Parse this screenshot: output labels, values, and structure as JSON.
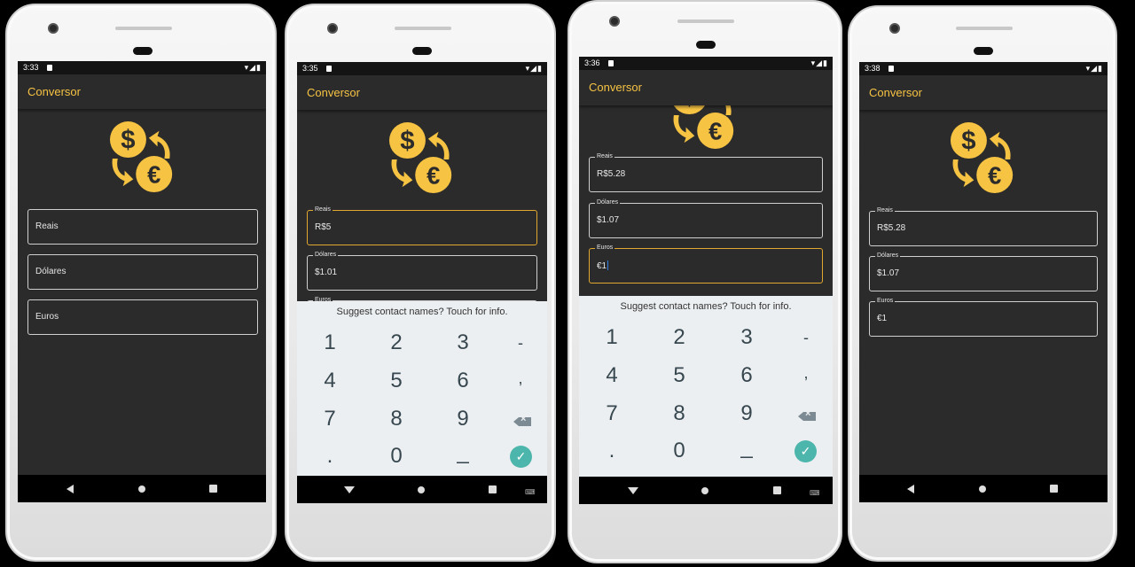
{
  "app": {
    "title": "Conversor",
    "accent": "#f6c343"
  },
  "status": {
    "signal_icons": "▾◢▮"
  },
  "keyboard": {
    "suggestion": "Suggest contact names? Touch for info.",
    "rows": [
      [
        "1",
        "2",
        "3",
        "-"
      ],
      [
        "4",
        "5",
        "6",
        ","
      ],
      [
        "7",
        "8",
        "9",
        "⌫"
      ],
      [
        ".",
        "0",
        "_",
        "✓"
      ]
    ]
  },
  "phones": [
    {
      "time": "3:33",
      "fields": [
        {
          "label": "",
          "placeholder": "Reais",
          "value": ""
        },
        {
          "label": "",
          "placeholder": "Dólares",
          "value": ""
        },
        {
          "label": "",
          "placeholder": "Euros",
          "value": ""
        }
      ]
    },
    {
      "time": "3:35",
      "fields": [
        {
          "label": "Reais",
          "value": "R$5"
        },
        {
          "label": "Dólares",
          "value": "$1.01"
        },
        {
          "label": "Euros",
          "value": ""
        }
      ]
    },
    {
      "time": "3:36",
      "fields": [
        {
          "label": "Reais",
          "value": "R$5.28"
        },
        {
          "label": "Dólares",
          "value": "$1.07"
        },
        {
          "label": "Euros",
          "value": "€1"
        }
      ]
    },
    {
      "time": "3:38",
      "fields": [
        {
          "label": "Reais",
          "value": "R$5.28"
        },
        {
          "label": "Dólares",
          "value": "$1.07"
        },
        {
          "label": "Euros",
          "value": "€1"
        }
      ]
    }
  ]
}
